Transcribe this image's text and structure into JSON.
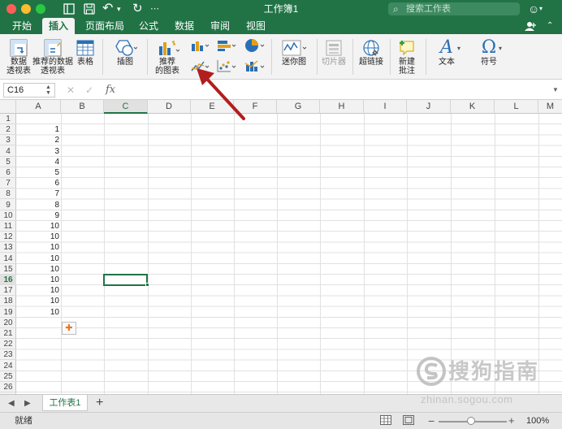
{
  "window": {
    "title": "工作簿1",
    "search_placeholder": "搜索工作表"
  },
  "titlebar": {
    "icons": [
      "sidebar-icon",
      "save-icon",
      "undo-icon",
      "redo-icon",
      "customize-icon"
    ],
    "undo_glyph": "↶",
    "redo_glyph": "↻"
  },
  "tabs": [
    {
      "label": "开始"
    },
    {
      "label": "插入"
    },
    {
      "label": "页面布局"
    },
    {
      "label": "公式"
    },
    {
      "label": "数据"
    },
    {
      "label": "审阅"
    },
    {
      "label": "视图"
    }
  ],
  "active_tab": "插入",
  "ribbon": {
    "pivot_table": "数据\n透视表",
    "recommended_pivot": "推荐的数据\n透视表",
    "table": "表格",
    "illustrations": "插图",
    "recommended_charts": "推荐\n的图表",
    "sparklines": "迷你图",
    "slicer": "切片器",
    "hyperlink": "超链接",
    "new_comment": "新建\n批注",
    "text": "文本",
    "symbol": "符号",
    "symbol_glyph": "Ω",
    "text_glyph": "A"
  },
  "formula_bar": {
    "name_box": "C16",
    "fx": "fx",
    "cancel": "✕",
    "enter": "✓",
    "value": ""
  },
  "columns": [
    "A",
    "B",
    "C",
    "D",
    "E",
    "F",
    "G",
    "H",
    "I",
    "J",
    "K",
    "L",
    "M"
  ],
  "rows": [
    "1",
    "2",
    "3",
    "4",
    "5",
    "6",
    "7",
    "8",
    "9",
    "10",
    "11",
    "12",
    "13",
    "14",
    "15",
    "16",
    "17",
    "18",
    "19",
    "20",
    "21",
    "22",
    "23",
    "24",
    "25",
    "26"
  ],
  "col_a_values": [
    "",
    "1",
    "2",
    "3",
    "4",
    "5",
    "6",
    "7",
    "8",
    "9",
    "10",
    "10",
    "10",
    "10",
    "10",
    "10",
    "10",
    "10",
    "10"
  ],
  "selected_cell": {
    "column": "C",
    "row": "16"
  },
  "paste_options": "✚",
  "sheets": [
    {
      "name": "工作表1"
    }
  ],
  "add_sheet": "+",
  "sheet_nav": {
    "prev": "◀",
    "next": "▶"
  },
  "status": {
    "ready": "就绪",
    "zoom": "100%",
    "zoom_minus": "−",
    "zoom_plus": "+"
  },
  "watermark": {
    "main": "搜狗指南",
    "url": "zhinan.sogou.com"
  },
  "colors": {
    "accent": "#217346",
    "annotation_arrow": "#b21e1e"
  }
}
